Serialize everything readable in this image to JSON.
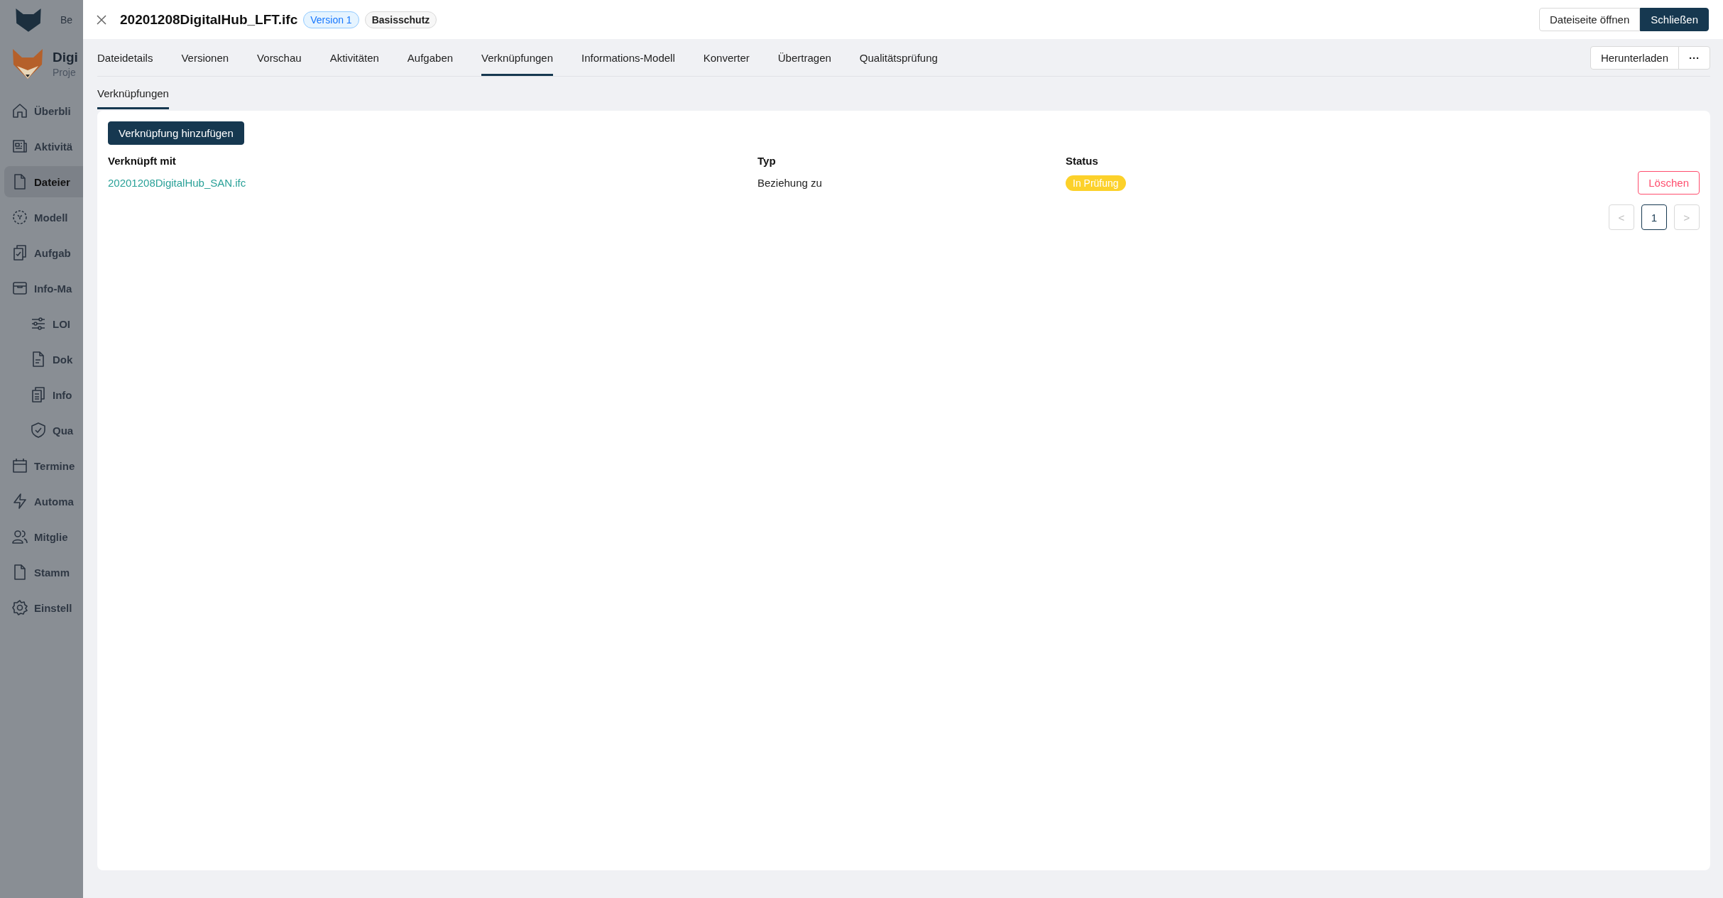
{
  "sidebar": {
    "top_text": "Be",
    "project": {
      "name": "Digi",
      "subtitle": "Proje"
    },
    "items": [
      {
        "label": "Überbli",
        "selected": false
      },
      {
        "label": "Aktivitä",
        "selected": false
      },
      {
        "label": "Dateier",
        "selected": true
      },
      {
        "label": "Modell",
        "selected": false
      },
      {
        "label": "Aufgab",
        "selected": false
      },
      {
        "label": "Info-Ma",
        "selected": false,
        "children": [
          {
            "label": "LOI",
            "selected": false
          },
          {
            "label": "Dok",
            "selected": false
          },
          {
            "label": "Info",
            "selected": false
          },
          {
            "label": "Qua",
            "selected": false
          }
        ]
      },
      {
        "label": "Termine",
        "selected": false
      },
      {
        "label": "Automa",
        "selected": false
      },
      {
        "label": "Mitglie",
        "selected": false
      },
      {
        "label": "Stamm",
        "selected": false
      },
      {
        "label": "Einstell",
        "selected": false
      }
    ]
  },
  "drawer": {
    "title": "20201208DigitalHub_LFT.ifc",
    "version_badge": "Version 1",
    "protection_badge": "Basisschutz",
    "buttons": [
      {
        "label": "Dateiseite öffnen",
        "kind": "default"
      },
      {
        "label": "Schließen",
        "kind": "primary"
      }
    ],
    "tabs": [
      {
        "label": "Dateidetails",
        "selected": false
      },
      {
        "label": "Versionen",
        "selected": false
      },
      {
        "label": "Vorschau",
        "selected": false
      },
      {
        "label": "Aktivitäten",
        "selected": false
      },
      {
        "label": "Aufgaben",
        "selected": false
      },
      {
        "label": "Verknüpfungen",
        "selected": true
      },
      {
        "label": "Informations-Modell",
        "selected": false
      },
      {
        "label": "Konverter",
        "selected": false
      },
      {
        "label": "Übertragen",
        "selected": false
      },
      {
        "label": "Qualitätsprüfung",
        "selected": false
      }
    ],
    "download_button": "Herunterladen",
    "more_button": "···",
    "subtabs": [
      {
        "label": "Verknüpfungen",
        "selected": true
      }
    ],
    "add_button": "Verknüpfung hinzufügen",
    "table": {
      "columns": [
        "Verknüpft mit",
        "Typ",
        "Status"
      ],
      "rows": [
        {
          "linked": "20201208DigitalHub_SAN.ifc",
          "type": "Beziehung zu",
          "status": "In Prüfung",
          "color": "#fcd12a",
          "action": "Löschen"
        }
      ]
    },
    "pagination": {
      "prev": "<",
      "next": ">",
      "pages": [
        {
          "label": "1",
          "selected": true
        }
      ],
      "prev_disabled": true,
      "next_disabled": true
    }
  }
}
